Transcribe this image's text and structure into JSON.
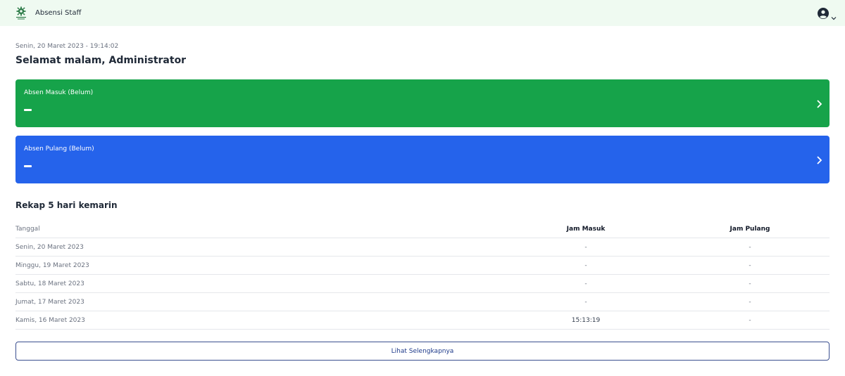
{
  "app": {
    "title": "Absensi Staff"
  },
  "header": {
    "logo_icon": "organization-emblem-icon",
    "user_icon": "user-circle-icon",
    "dropdown_icon": "chevron-down-icon"
  },
  "datetime": "Senin, 20 Maret 2023 - 19:14:02",
  "greeting": "Selamat malam, Administrator",
  "cards": {
    "masuk": {
      "title": "Absen Masuk (Belum)",
      "value": "–",
      "color": "#16a34a"
    },
    "pulang": {
      "title": "Absen Pulang (Belum)",
      "value": "–",
      "color": "#2563eb"
    }
  },
  "rekap": {
    "title": "Rekap 5 hari kemarin",
    "columns": [
      "Tanggal",
      "Jam Masuk",
      "Jam Pulang"
    ],
    "rows": [
      {
        "tanggal": "Senin, 20 Maret 2023",
        "masuk": "-",
        "pulang": "-"
      },
      {
        "tanggal": "Minggu, 19 Maret 2023",
        "masuk": "-",
        "pulang": "-"
      },
      {
        "tanggal": "Sabtu, 18 Maret 2023",
        "masuk": "-",
        "pulang": "-"
      },
      {
        "tanggal": "Jumat, 17 Maret 2023",
        "masuk": "-",
        "pulang": "-"
      },
      {
        "tanggal": "Kamis, 16 Maret 2023",
        "masuk": "15:13:19",
        "pulang": "-"
      }
    ],
    "more_label": "Lihat Selengkapnya"
  }
}
